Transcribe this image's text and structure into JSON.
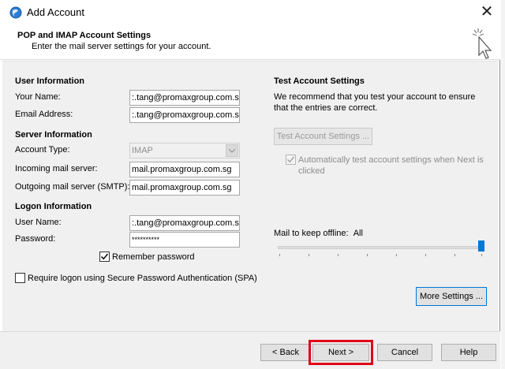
{
  "window": {
    "title": "Add Account"
  },
  "header": {
    "title": "POP and IMAP Account Settings",
    "subtitle": "Enter the mail server settings for your account."
  },
  "user_info": {
    "heading": "User Information",
    "your_name_label": "Your Name:",
    "your_name_value": ":.tang@promaxgroup.com.sg",
    "email_label": "Email Address:",
    "email_value": ":.tang@promaxgroup.com.sg"
  },
  "server_info": {
    "heading": "Server Information",
    "account_type_label": "Account Type:",
    "account_type_value": "IMAP",
    "incoming_label": "Incoming mail server:",
    "incoming_value": "mail.promaxgroup.com.sg",
    "outgoing_label": "Outgoing mail server (SMTP):",
    "outgoing_value": "mail.promaxgroup.com.sg"
  },
  "logon_info": {
    "heading": "Logon Information",
    "username_label": "User Name:",
    "username_value": ":.tang@promaxgroup.com.sg",
    "password_label": "Password:",
    "password_value": "**********",
    "remember_label": "Remember password",
    "remember_checked": true,
    "spa_label": "Require logon using Secure Password Authentication (SPA)",
    "spa_checked": false
  },
  "test_settings": {
    "heading": "Test Account Settings",
    "description": "We recommend that you test your account to ensure that the entries are correct.",
    "test_button": "Test Account Settings ...",
    "auto_test_label": "Automatically test account settings when Next is clicked",
    "auto_test_checked": true
  },
  "offline": {
    "label": "Mail to keep offline:",
    "value": "All",
    "slider_fraction": 1.0
  },
  "more_settings_button": "More Settings ...",
  "footer": {
    "back": "< Back",
    "next": "Next >",
    "cancel": "Cancel",
    "help": "Help"
  },
  "colors": {
    "accent": "#0078d7",
    "highlight": "#e0001b"
  }
}
